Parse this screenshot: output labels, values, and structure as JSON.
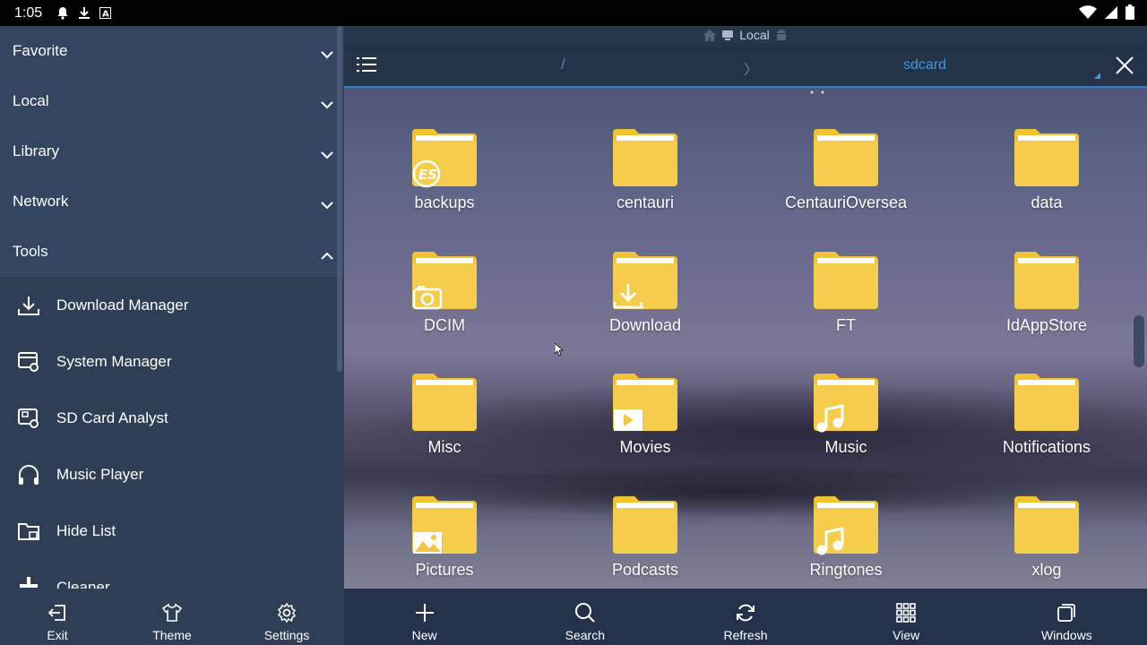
{
  "status_bar": {
    "time": "1:05"
  },
  "tab_strip": {
    "label": "Local"
  },
  "path_bar": {
    "root": "/",
    "separator": "〉",
    "current": "sdcard"
  },
  "sidebar": {
    "sections": [
      {
        "label": "Favorite",
        "icon": "chevron-down-icon"
      },
      {
        "label": "Local",
        "icon": "chevron-down-icon"
      },
      {
        "label": "Library",
        "icon": "chevron-down-icon"
      },
      {
        "label": "Network",
        "icon": "chevron-down-icon"
      },
      {
        "label": "Tools",
        "icon": "chevron-up-icon"
      }
    ],
    "tools": [
      {
        "label": "Download Manager",
        "icon": "download-icon"
      },
      {
        "label": "System Manager",
        "icon": "system-manager-icon"
      },
      {
        "label": "SD Card Analyst",
        "icon": "sd-card-icon"
      },
      {
        "label": "Music Player",
        "icon": "headphones-icon"
      },
      {
        "label": "Hide List",
        "icon": "hidden-folder-icon"
      },
      {
        "label": "Cleaner",
        "icon": "cleaner-icon"
      }
    ]
  },
  "bottom_left": [
    {
      "label": "Exit",
      "icon": "exit-icon"
    },
    {
      "label": "Theme",
      "icon": "shirt-icon"
    },
    {
      "label": "Settings",
      "icon": "gear-icon"
    }
  ],
  "bottom_right": [
    {
      "label": "New",
      "icon": "plus-icon"
    },
    {
      "label": "Search",
      "icon": "search-icon"
    },
    {
      "label": "Refresh",
      "icon": "refresh-icon"
    },
    {
      "label": "View",
      "icon": "grid-icon"
    },
    {
      "label": "Windows",
      "icon": "windows-icon"
    }
  ],
  "files": [
    {
      "name": "backups",
      "badge": "es"
    },
    {
      "name": "centauri",
      "badge": ""
    },
    {
      "name": "CentauriOversea",
      "badge": ""
    },
    {
      "name": "data",
      "badge": ""
    },
    {
      "name": "DCIM",
      "badge": "camera"
    },
    {
      "name": "Download",
      "badge": "download"
    },
    {
      "name": "FT",
      "badge": ""
    },
    {
      "name": "IdAppStore",
      "badge": ""
    },
    {
      "name": "Misc",
      "badge": ""
    },
    {
      "name": "Movies",
      "badge": "play"
    },
    {
      "name": "Music",
      "badge": "note"
    },
    {
      "name": "Notifications",
      "badge": ""
    },
    {
      "name": "Pictures",
      "badge": "picture"
    },
    {
      "name": "Podcasts",
      "badge": ""
    },
    {
      "name": "Ringtones",
      "badge": "note"
    },
    {
      "name": "xlog",
      "badge": ""
    }
  ],
  "colors": {
    "accent": "#3c9be0",
    "folder": "#f4c542",
    "sidebar": "#2e3f55"
  }
}
